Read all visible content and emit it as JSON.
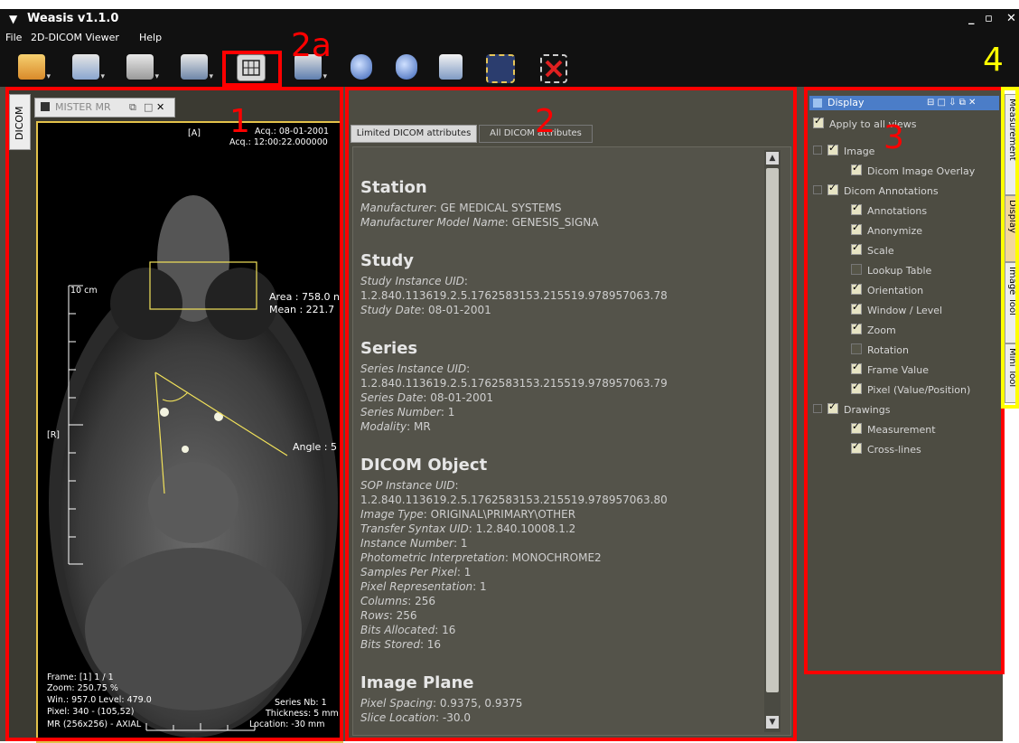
{
  "window": {
    "title": "Weasis v1.1.0"
  },
  "menu": [
    "File",
    "2D-DICOM Viewer",
    "Help"
  ],
  "toolbar": {
    "icons": [
      "open-dicom-icon",
      "import-icon",
      "export-icon",
      "print-icon",
      "layout-grid-icon",
      "sync-icon",
      "zoom-1-icon",
      "zoom-fit-icon",
      "save-icon",
      "crosshair-icon",
      "delete-measure-icon"
    ]
  },
  "viewer": {
    "side_tab": "DICOM",
    "tab_label": "MISTER MR",
    "overlay": {
      "orient_top": "[A]",
      "acq_date": "Acq.: 08-01-2001",
      "acq_time": "Acq.: 12:00:22.000000",
      "scale_label": "10 cm",
      "area": "Area : 758.0 n",
      "mean": "Mean : 221.7",
      "orient_left": "[R]",
      "angle": "Angle : 5",
      "frame": "Frame: [1] 1 / 1",
      "zoom": "Zoom: 250.75 %",
      "win_level": "Win.: 957.0 Level: 479.0",
      "pixel": "Pixel: 340 - (105,52)",
      "mr_info": "MR (256x256) - AXIAL",
      "series_nb": "Series Nb: 1",
      "thickness": "Thickness: 5 mm",
      "location": "Location: -30 mm"
    }
  },
  "attributes": {
    "tabs": [
      "Limited DICOM attributes",
      "All DICOM attributes"
    ],
    "sections": [
      {
        "title": "Station",
        "rows": [
          {
            "k": "Manufacturer",
            "v": "GE MEDICAL SYSTEMS"
          },
          {
            "k": "Manufacturer Model Name",
            "v": "GENESIS_SIGNA"
          }
        ]
      },
      {
        "title": "Study",
        "rows": [
          {
            "k": "Study Instance UID",
            "v": ""
          },
          {
            "k": "",
            "v": "1.2.840.113619.2.5.1762583153.215519.978957063.78"
          },
          {
            "k": "Study Date",
            "v": "08-01-2001"
          }
        ]
      },
      {
        "title": "Series",
        "rows": [
          {
            "k": "Series Instance UID",
            "v": ""
          },
          {
            "k": "",
            "v": "1.2.840.113619.2.5.1762583153.215519.978957063.79"
          },
          {
            "k": "Series Date",
            "v": "08-01-2001"
          },
          {
            "k": "Series Number",
            "v": "1"
          },
          {
            "k": "Modality",
            "v": "MR"
          }
        ]
      },
      {
        "title": "DICOM Object",
        "rows": [
          {
            "k": "SOP Instance UID",
            "v": ""
          },
          {
            "k": "",
            "v": "1.2.840.113619.2.5.1762583153.215519.978957063.80"
          },
          {
            "k": "Image Type",
            "v": "ORIGINAL\\PRIMARY\\OTHER"
          },
          {
            "k": "Transfer Syntax UID",
            "v": "1.2.840.10008.1.2"
          },
          {
            "k": "Instance Number",
            "v": "1"
          },
          {
            "k": "Photometric Interpretation",
            "v": "MONOCHROME2"
          },
          {
            "k": "Samples Per Pixel",
            "v": "1"
          },
          {
            "k": "Pixel Representation",
            "v": "1"
          },
          {
            "k": "Columns",
            "v": "256"
          },
          {
            "k": "Rows",
            "v": "256"
          },
          {
            "k": "Bits Allocated",
            "v": "16"
          },
          {
            "k": "Bits Stored",
            "v": "16"
          }
        ]
      },
      {
        "title": "Image Plane",
        "rows": [
          {
            "k": "Pixel Spacing",
            "v": "0.9375, 0.9375"
          },
          {
            "k": "Slice Location",
            "v": "-30.0"
          }
        ]
      }
    ]
  },
  "display": {
    "header": "Display",
    "apply_all": "Apply to all views",
    "tree": [
      {
        "label": "Image",
        "level": 0,
        "checked": true,
        "group": true
      },
      {
        "label": "Dicom Image Overlay",
        "level": 1,
        "checked": true
      },
      {
        "label": "Dicom Annotations",
        "level": 0,
        "checked": true,
        "group": true
      },
      {
        "label": "Annotations",
        "level": 1,
        "checked": true
      },
      {
        "label": "Anonymize",
        "level": 1,
        "checked": true
      },
      {
        "label": "Scale",
        "level": 1,
        "checked": true
      },
      {
        "label": "Lookup Table",
        "level": 1,
        "checked": false
      },
      {
        "label": "Orientation",
        "level": 1,
        "checked": true
      },
      {
        "label": "Window / Level",
        "level": 1,
        "checked": true
      },
      {
        "label": "Zoom",
        "level": 1,
        "checked": true
      },
      {
        "label": "Rotation",
        "level": 1,
        "checked": false
      },
      {
        "label": "Frame Value",
        "level": 1,
        "checked": true
      },
      {
        "label": "Pixel (Value/Position)",
        "level": 1,
        "checked": true
      },
      {
        "label": "Drawings",
        "level": 0,
        "checked": true,
        "group": true
      },
      {
        "label": "Measurement",
        "level": 1,
        "checked": true
      },
      {
        "label": "Cross-lines",
        "level": 1,
        "checked": true
      }
    ]
  },
  "side_tabs": [
    "Measurement",
    "Display",
    "Image Tool",
    "Mini Tool"
  ],
  "annotations": {
    "labels": [
      "1",
      "2",
      "2a",
      "3",
      "4"
    ]
  },
  "colors": {
    "accent_red": "#ff0000",
    "accent_yellow": "#ffff00",
    "image_border": "#e3c24a",
    "display_header": "#4b7dc8"
  }
}
